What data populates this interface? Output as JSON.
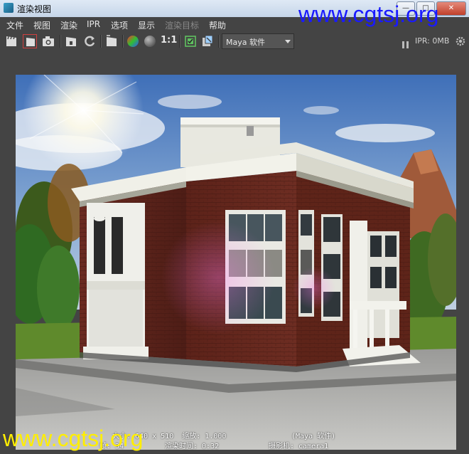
{
  "window": {
    "title": "渲染视图",
    "controls": {
      "minimize": "—",
      "maximize": "□",
      "close": "✕"
    }
  },
  "watermark": {
    "text": "www.cgtsj.org"
  },
  "menu": [
    "文件",
    "视图",
    "渲染",
    "IPR",
    "选项",
    "显示",
    "渲染目标",
    "帮助"
  ],
  "toolbar": {
    "ratio_label": "1:1",
    "renderer": "Maya 软件",
    "ipr_status": "IPR: 0MB"
  },
  "render_info": {
    "line1_left": "大小: 640 x 510  缩放: 1.000",
    "line1_right": "(Maya 软件)",
    "line2_left": "帧: 34",
    "line2_mid": "渲染时间: 0:32",
    "line2_right": "摄影机: camera1"
  },
  "colors": {
    "bg": "#444444",
    "watermark_top": "#1a1aff",
    "watermark_bottom": "#ffee00"
  }
}
